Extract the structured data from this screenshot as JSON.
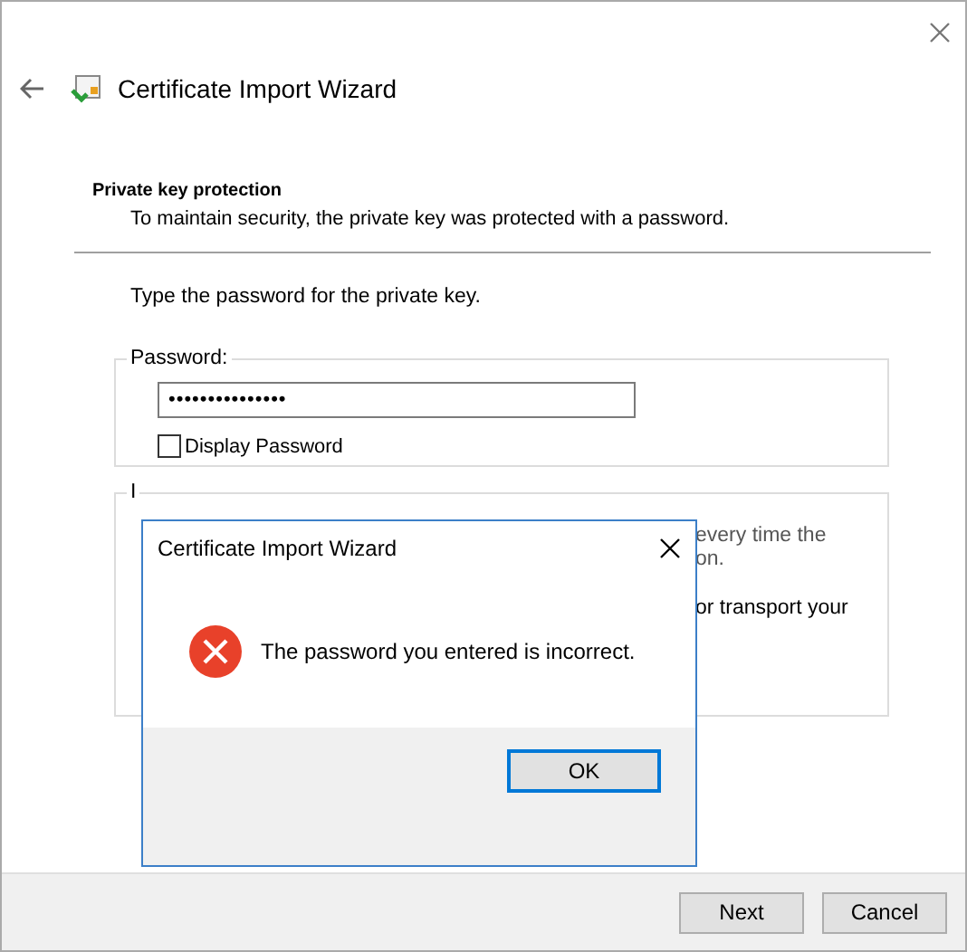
{
  "window": {
    "title": "Certificate Import Wizard"
  },
  "page": {
    "heading": "Private key protection",
    "subtitle": "To maintain security, the private key was protected with a password."
  },
  "prompt": "Type the password for the private key.",
  "password_group": {
    "legend": "Password:",
    "value": "•••••••••••••••",
    "display_password": {
      "label": "Display Password",
      "checked": false
    }
  },
  "options_group": {
    "legend": "I",
    "fragments": [
      "every time the",
      "on.",
      "or transport your"
    ]
  },
  "buttons": [
    {
      "label": "Next"
    },
    {
      "label": "Cancel"
    }
  ],
  "dialog": {
    "title": "Certificate Import Wizard",
    "message": "The password you entered is incorrect.",
    "button": "OK"
  }
}
